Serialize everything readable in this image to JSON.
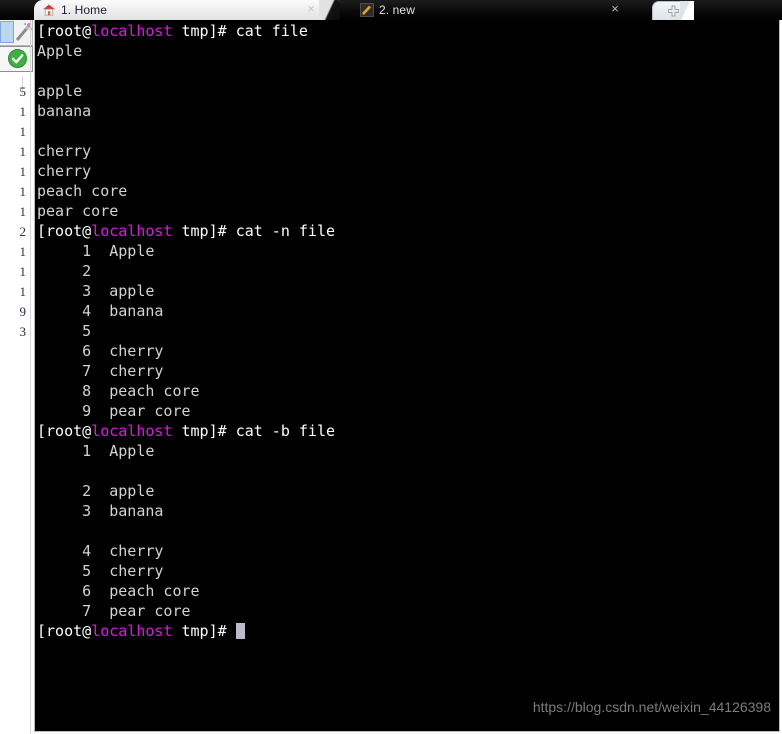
{
  "window": {
    "title": "Terminal",
    "background": "#000000",
    "foreground": "#d8d8d8",
    "host_color": "#e016e0",
    "watermark": "https://blog.csdn.net/weixin_44126398"
  },
  "tabs": {
    "items": [
      {
        "label": "1. Home",
        "icon": "home-icon",
        "active": true,
        "close_label": "×"
      },
      {
        "label": "2. new",
        "icon": "pencil-icon",
        "active": false,
        "close_label": "×"
      }
    ],
    "add_label": "+"
  },
  "sidebar": {
    "icons": [
      "blue-rect-icon",
      "magic-wand-icon",
      "green-check-icon"
    ],
    "numbers": [
      "5",
      "1",
      "1",
      "1",
      "1",
      "1",
      "1",
      "2",
      "1",
      "1",
      "1",
      "9",
      "3"
    ]
  },
  "terminal": {
    "prompt": {
      "prefix": "[root@",
      "host": "localhost",
      "suffix": " tmp]# "
    },
    "lines": [
      {
        "type": "prompt",
        "command": "cat file"
      },
      {
        "type": "output",
        "text": "Apple"
      },
      {
        "type": "output",
        "text": ""
      },
      {
        "type": "output",
        "text": "apple"
      },
      {
        "type": "output",
        "text": "banana"
      },
      {
        "type": "output",
        "text": ""
      },
      {
        "type": "output",
        "text": "cherry"
      },
      {
        "type": "output",
        "text": "cherry"
      },
      {
        "type": "output",
        "text": "peach core"
      },
      {
        "type": "output",
        "text": "pear core"
      },
      {
        "type": "prompt",
        "command": "cat -n file"
      },
      {
        "type": "output",
        "text": "     1\tApple"
      },
      {
        "type": "output",
        "text": "     2\t"
      },
      {
        "type": "output",
        "text": "     3\tapple"
      },
      {
        "type": "output",
        "text": "     4\tbanana"
      },
      {
        "type": "output",
        "text": "     5\t"
      },
      {
        "type": "output",
        "text": "     6\tcherry"
      },
      {
        "type": "output",
        "text": "     7\tcherry"
      },
      {
        "type": "output",
        "text": "     8\tpeach core"
      },
      {
        "type": "output",
        "text": "     9\tpear core"
      },
      {
        "type": "prompt",
        "command": "cat -b file"
      },
      {
        "type": "output",
        "text": "     1\tApple"
      },
      {
        "type": "output",
        "text": ""
      },
      {
        "type": "output",
        "text": "     2\tapple"
      },
      {
        "type": "output",
        "text": "     3\tbanana"
      },
      {
        "type": "output",
        "text": ""
      },
      {
        "type": "output",
        "text": "     4\tcherry"
      },
      {
        "type": "output",
        "text": "     5\tcherry"
      },
      {
        "type": "output",
        "text": "     6\tpeach core"
      },
      {
        "type": "output",
        "text": "     7\tpear core"
      },
      {
        "type": "prompt",
        "command": "",
        "cursor": true
      }
    ]
  }
}
